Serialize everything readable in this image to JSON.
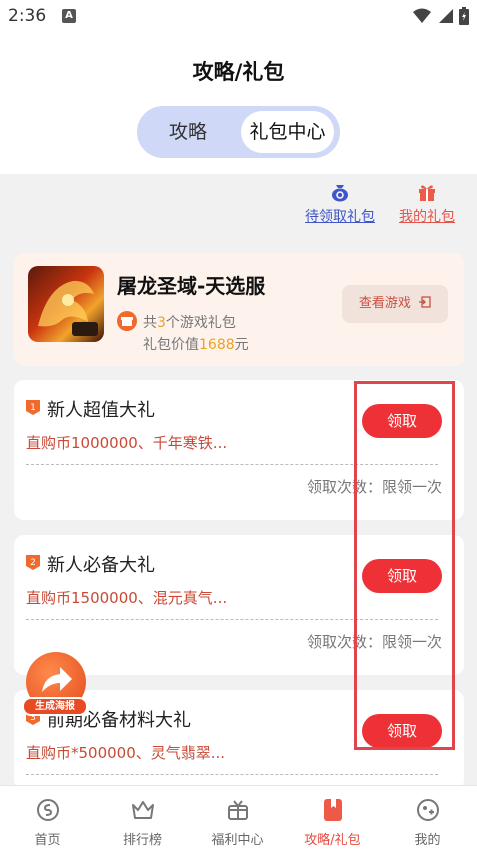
{
  "status_bar": {
    "time": "2:36",
    "notif_letter": "A"
  },
  "header": {
    "title": "攻略/礼包",
    "tabs": [
      {
        "label": "攻略",
        "active": false
      },
      {
        "label": "礼包中心",
        "active": true
      }
    ]
  },
  "links": {
    "pending": "待领取礼包",
    "mine": "我的礼包"
  },
  "game": {
    "name": "屠龙圣域-天选服",
    "summary_pre": "共",
    "summary_num": "3",
    "summary_post": "个游戏礼包",
    "value_pre": "礼包价值",
    "value_num": "1688",
    "value_post": "元",
    "view_button": "查看游戏",
    "thumb_label": "正版"
  },
  "gifts": [
    {
      "index": "1",
      "title": "新人超值大礼",
      "desc": "直购币1000000、千年寒铁...",
      "count_label": "领取次数：",
      "count_value": "限领一次",
      "claim_label": "领取"
    },
    {
      "index": "2",
      "title": "新人必备大礼",
      "desc": "直购币1500000、混元真气...",
      "count_label": "领取次数：",
      "count_value": "限领一次",
      "claim_label": "领取"
    },
    {
      "index": "3",
      "title": "前期必备材料大礼",
      "desc": "直购币*500000、灵气翡翠...",
      "count_label": "",
      "count_value": "",
      "claim_label": "领取"
    }
  ],
  "fab": {
    "label": "生成海报"
  },
  "bottom_tabs": [
    {
      "label": "首页",
      "icon": "home-coin-icon",
      "active": false
    },
    {
      "label": "排行榜",
      "icon": "crown-icon",
      "active": false
    },
    {
      "label": "福利中心",
      "icon": "gift-box-icon",
      "active": false
    },
    {
      "label": "攻略/礼包",
      "icon": "book-icon",
      "active": true
    },
    {
      "label": "我的",
      "icon": "profile-icon",
      "active": false
    }
  ],
  "colors": {
    "accent_red": "#ee3136",
    "tab_active": "#e84a3e",
    "link_blue": "#3f55c8",
    "segment_bg": "#cfd8f7"
  }
}
